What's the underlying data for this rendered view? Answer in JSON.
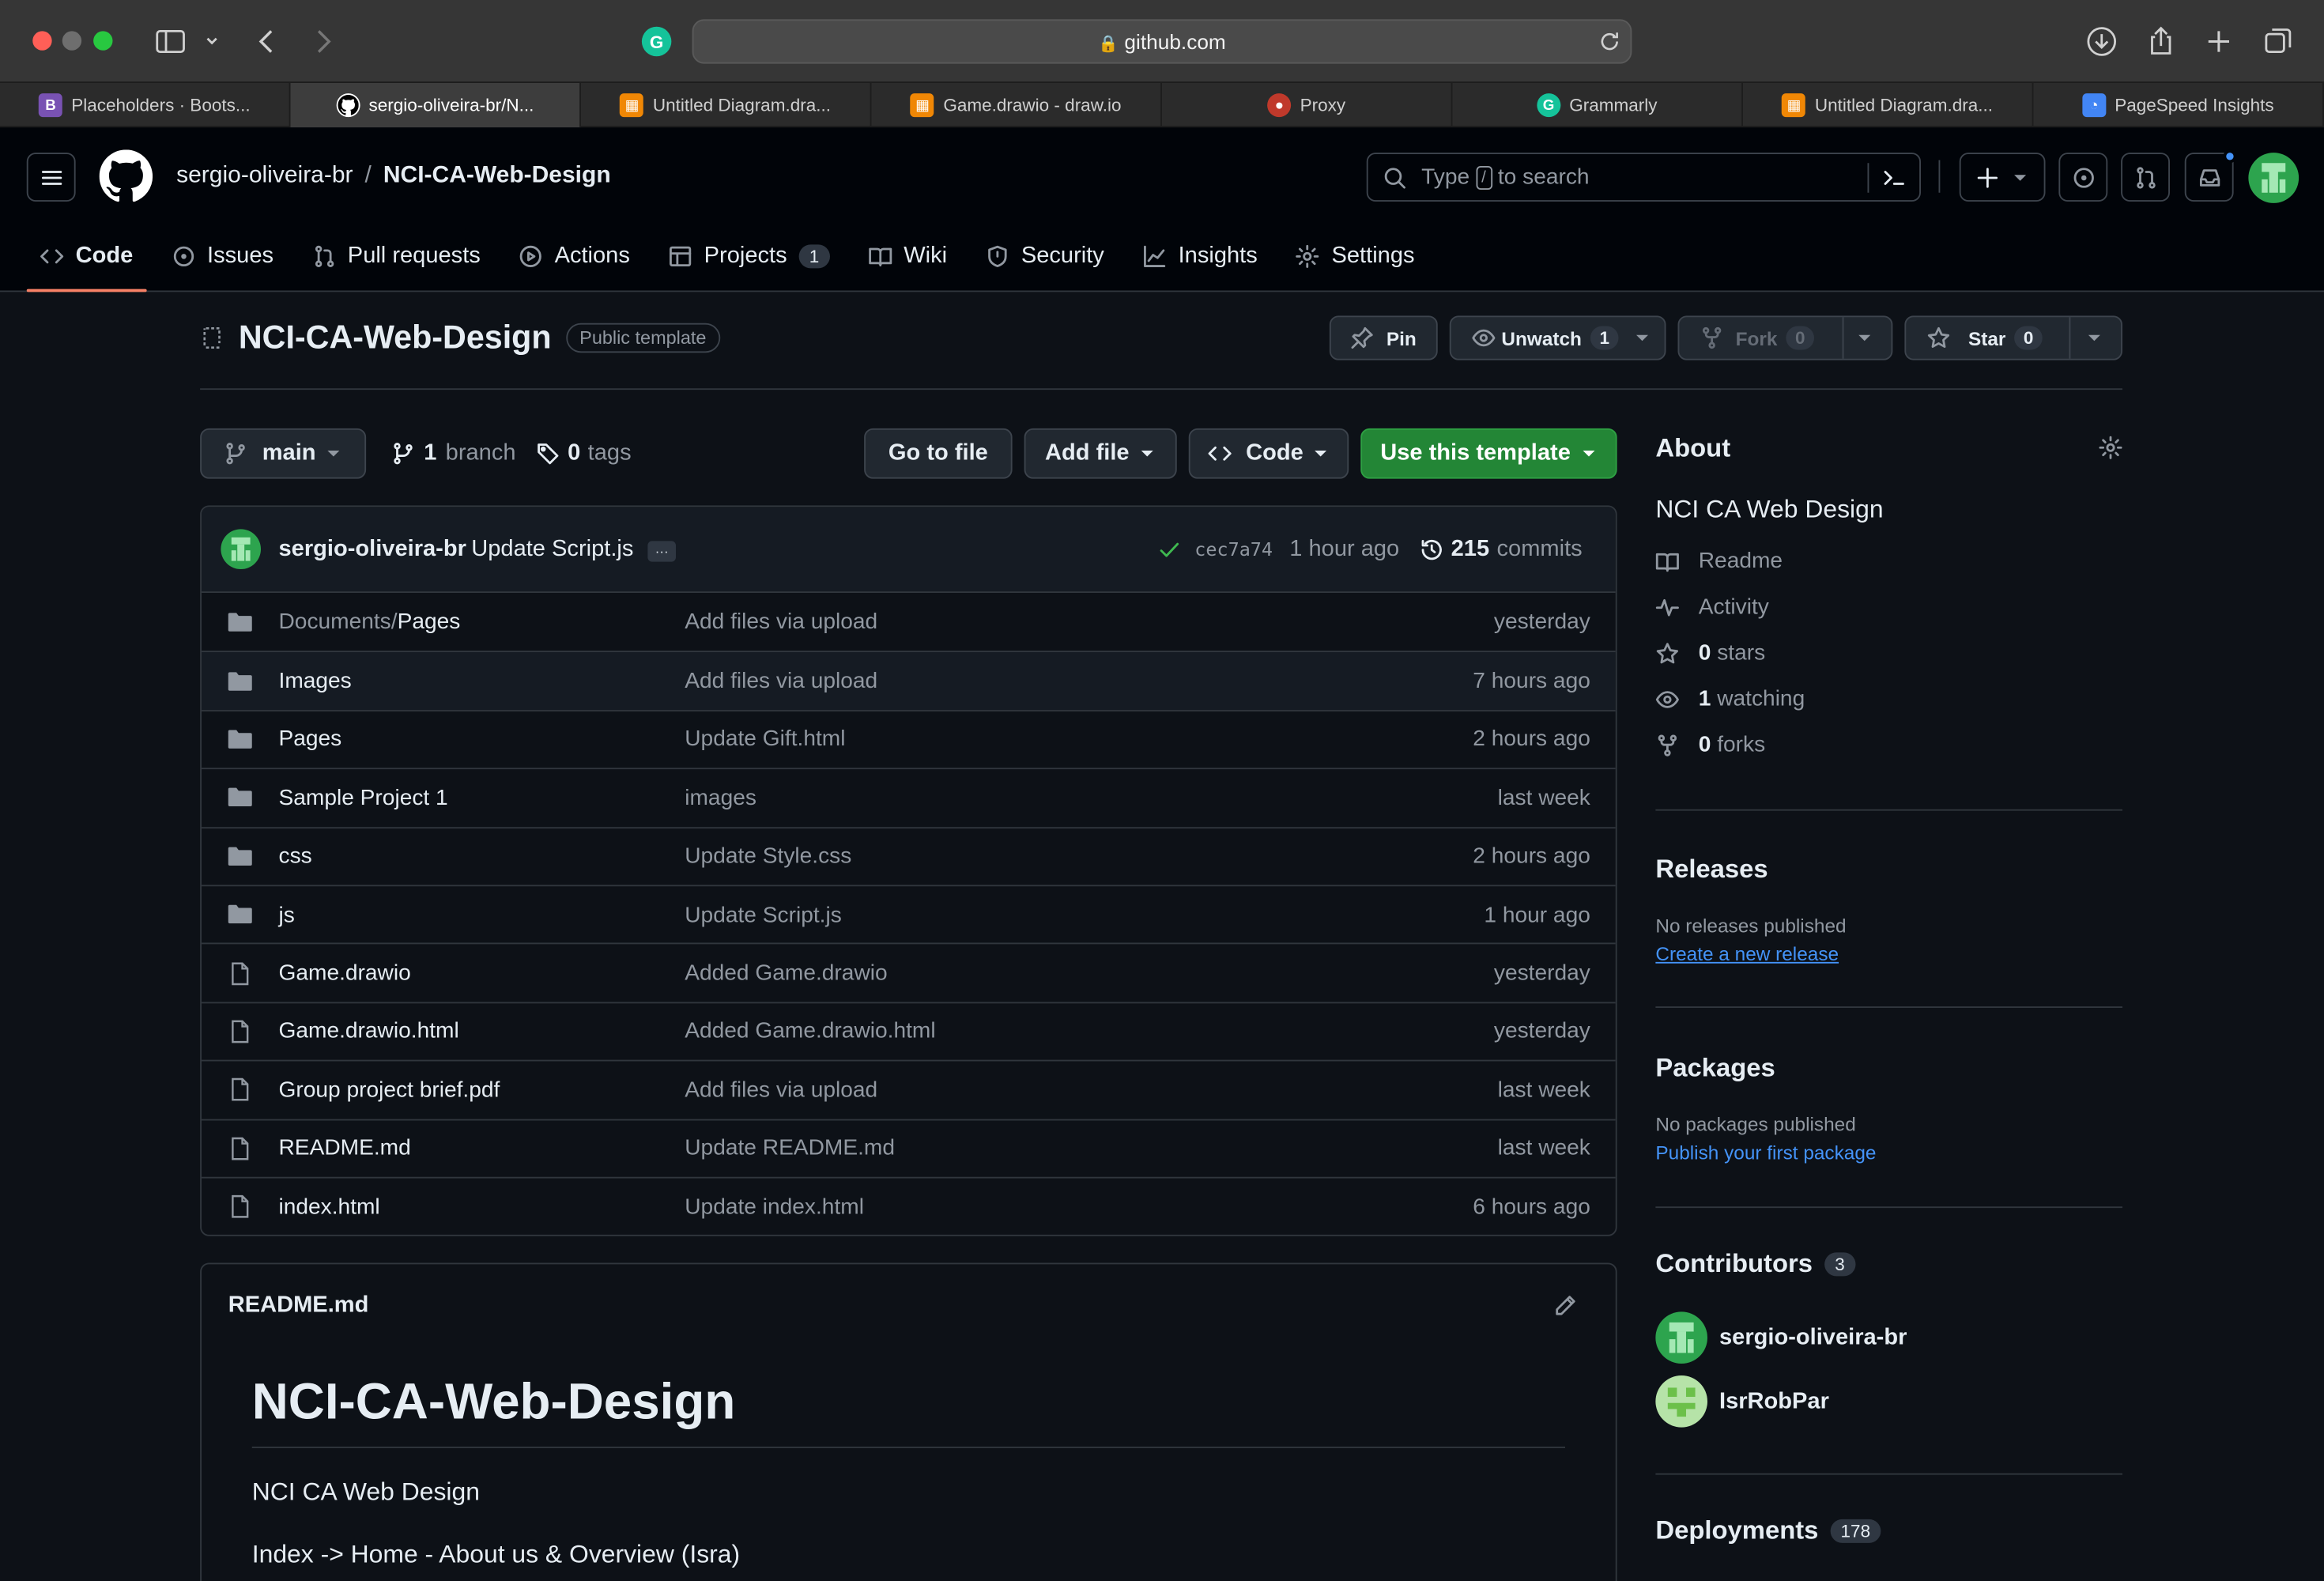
{
  "browser": {
    "url": "github.com",
    "tabs": [
      {
        "label": "Placeholders · Boots...",
        "icon": "bootstrap-icon",
        "active": false
      },
      {
        "label": "sergio-oliveira-br/N...",
        "icon": "github-icon",
        "active": true
      },
      {
        "label": "Untitled Diagram.dra...",
        "icon": "drawio-icon",
        "active": false
      },
      {
        "label": "Game.drawio - draw.io",
        "icon": "drawio-icon",
        "active": false
      },
      {
        "label": "Proxy",
        "icon": "proxy-icon",
        "active": false
      },
      {
        "label": "Grammarly",
        "icon": "grammarly-icon",
        "active": false
      },
      {
        "label": "Untitled Diagram.dra...",
        "icon": "drawio-icon",
        "active": false
      },
      {
        "label": "PageSpeed Insights",
        "icon": "pagespeed-icon",
        "active": false
      }
    ]
  },
  "header": {
    "owner": "sergio-oliveira-br",
    "separator": "/",
    "repo": "NCI-CA-Web-Design",
    "search_placeholder_pre": "Type",
    "search_key": "/",
    "search_placeholder_post": "to search"
  },
  "nav": {
    "code": "Code",
    "issues": "Issues",
    "pulls": "Pull requests",
    "actions": "Actions",
    "projects": "Projects",
    "projects_count": "1",
    "wiki": "Wiki",
    "security": "Security",
    "insights": "Insights",
    "settings": "Settings"
  },
  "repo": {
    "name": "NCI-CA-Web-Design",
    "visibility": "Public template",
    "pin": "Pin",
    "unwatch": "Unwatch",
    "watch_count": "1",
    "fork": "Fork",
    "fork_count": "0",
    "star": "Star",
    "star_count": "0"
  },
  "toolbar": {
    "branch": "main",
    "branch_count": "1",
    "branch_label": "branch",
    "tag_count": "0",
    "tag_label": "tags",
    "goto": "Go to file",
    "addfile": "Add file",
    "code": "Code",
    "template": "Use this template"
  },
  "commit": {
    "author": "sergio-oliveira-br",
    "message": "Update Script.js",
    "more": "···",
    "hash": "cec7a74",
    "time": "1 hour ago",
    "count": "215",
    "count_label": "commits"
  },
  "files": [
    {
      "type": "dir",
      "prefix": "Documents/",
      "name": "Pages",
      "msg": "Add files via upload",
      "time": "yesterday"
    },
    {
      "type": "dir",
      "prefix": "",
      "name": "Images",
      "msg": "Add files via upload",
      "time": "7 hours ago"
    },
    {
      "type": "dir",
      "prefix": "",
      "name": "Pages",
      "msg": "Update Gift.html",
      "time": "2 hours ago"
    },
    {
      "type": "dir",
      "prefix": "",
      "name": "Sample Project 1",
      "msg": "images",
      "time": "last week"
    },
    {
      "type": "dir",
      "prefix": "",
      "name": "css",
      "msg": "Update Style.css",
      "time": "2 hours ago"
    },
    {
      "type": "dir",
      "prefix": "",
      "name": "js",
      "msg": "Update Script.js",
      "time": "1 hour ago"
    },
    {
      "type": "file",
      "prefix": "",
      "name": "Game.drawio",
      "msg": "Added Game.drawio",
      "time": "yesterday"
    },
    {
      "type": "file",
      "prefix": "",
      "name": "Game.drawio.html",
      "msg": "Added Game.drawio.html",
      "time": "yesterday"
    },
    {
      "type": "file",
      "prefix": "",
      "name": "Group project brief.pdf",
      "msg": "Add files via upload",
      "time": "last week"
    },
    {
      "type": "file",
      "prefix": "",
      "name": "README.md",
      "msg": "Update README.md",
      "time": "last week"
    },
    {
      "type": "file",
      "prefix": "",
      "name": "index.html",
      "msg": "Update index.html",
      "time": "6 hours ago"
    }
  ],
  "readme": {
    "filename": "README.md",
    "title": "NCI-CA-Web-Design",
    "line1": "NCI CA Web Design",
    "line2": "Index -> Home - About us & Overview (Isra)"
  },
  "about": {
    "heading": "About",
    "description": "NCI CA Web Design",
    "readme": "Readme",
    "activity": "Activity",
    "stars_count": "0",
    "stars_label": "stars",
    "watching_count": "1",
    "watching_label": "watching",
    "forks_count": "0",
    "forks_label": "forks"
  },
  "releases": {
    "heading": "Releases",
    "none": "No releases published",
    "link": "Create a new release"
  },
  "packages": {
    "heading": "Packages",
    "none": "No packages published",
    "link": "Publish your first package"
  },
  "contributors": {
    "heading": "Contributors",
    "count": "3",
    "people": [
      "sergio-oliveira-br",
      "IsrRobPar"
    ]
  },
  "deployments": {
    "heading": "Deployments",
    "count": "178"
  },
  "colors": {
    "accent_green": "#238636",
    "link_blue": "#4493f8",
    "tab_underline": "#f78166",
    "bg": "#0d1117"
  }
}
